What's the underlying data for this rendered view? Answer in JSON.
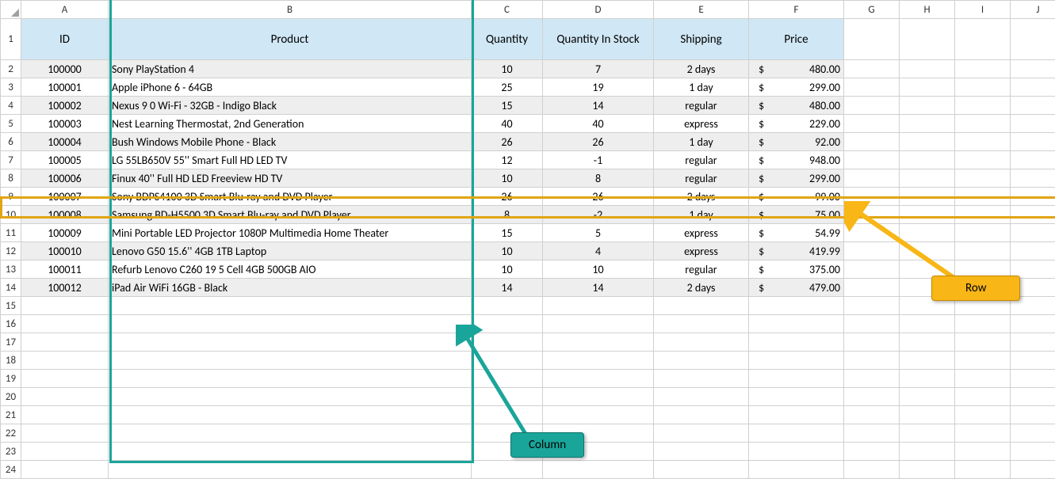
{
  "column_letters": [
    "A",
    "B",
    "C",
    "D",
    "E",
    "F",
    "G",
    "H",
    "I",
    "J"
  ],
  "row_numbers": [
    "1",
    "2",
    "3",
    "4",
    "5",
    "6",
    "7",
    "8",
    "9",
    "10",
    "11",
    "12",
    "13",
    "14",
    "15",
    "16",
    "17",
    "18",
    "19",
    "20",
    "21",
    "22",
    "23",
    "24"
  ],
  "headers": {
    "A": "ID",
    "B": "Product",
    "C": "Quantity",
    "D": "Quantity In Stock",
    "E": "Shipping",
    "F": "Price"
  },
  "currency": "$",
  "rows": [
    {
      "id": "100000",
      "product": "Sony PlayStation 4",
      "qty": "10",
      "stock": "7",
      "ship": "2 days",
      "price": "480.00"
    },
    {
      "id": "100001",
      "product": "Apple iPhone 6 - 64GB",
      "qty": "25",
      "stock": "19",
      "ship": "1 day",
      "price": "299.00"
    },
    {
      "id": "100002",
      "product": "Nexus 9 0 Wi-Fi - 32GB - Indigo Black",
      "qty": "15",
      "stock": "14",
      "ship": "regular",
      "price": "480.00"
    },
    {
      "id": "100003",
      "product": "Nest Learning Thermostat, 2nd Generation",
      "qty": "40",
      "stock": "40",
      "ship": "express",
      "price": "229.00"
    },
    {
      "id": "100004",
      "product": "Bush Windows Mobile Phone - Black",
      "qty": "26",
      "stock": "26",
      "ship": "1 day",
      "price": "92.00"
    },
    {
      "id": "100005",
      "product": "LG 55LB650V 55'' Smart Full HD LED TV",
      "qty": "12",
      "stock": "-1",
      "ship": "regular",
      "price": "948.00"
    },
    {
      "id": "100006",
      "product": "Finux 40'' Full HD LED Freeview HD TV",
      "qty": "10",
      "stock": "8",
      "ship": "regular",
      "price": "299.00"
    },
    {
      "id": "100007",
      "product": "Sony BDPS4100 3D Smart Blu-ray and DVD Player",
      "qty": "26",
      "stock": "26",
      "ship": "2 days",
      "price": "99.00"
    },
    {
      "id": "100008",
      "product": "Samsung BD-H5500 3D Smart Blu-ray and DVD Player",
      "qty": "8",
      "stock": "-2",
      "ship": "1 day",
      "price": "75.00"
    },
    {
      "id": "100009",
      "product": "Mini Portable LED Projector 1080P Multimedia Home Theater",
      "qty": "15",
      "stock": "5",
      "ship": "express",
      "price": "54.99"
    },
    {
      "id": "100010",
      "product": "Lenovo G50 15.6'' 4GB 1TB Laptop",
      "qty": "10",
      "stock": "4",
      "ship": "express",
      "price": "419.99"
    },
    {
      "id": "100011",
      "product": "Refurb Lenovo C260 19 5 Cell 4GB 500GB AIO",
      "qty": "10",
      "stock": "10",
      "ship": "regular",
      "price": "375.00"
    },
    {
      "id": "100012",
      "product": "iPad Air WiFi 16GB - Black",
      "qty": "14",
      "stock": "14",
      "ship": "2 days",
      "price": "479.00"
    }
  ],
  "annotations": {
    "column_label": "Column",
    "row_label": "Row"
  }
}
